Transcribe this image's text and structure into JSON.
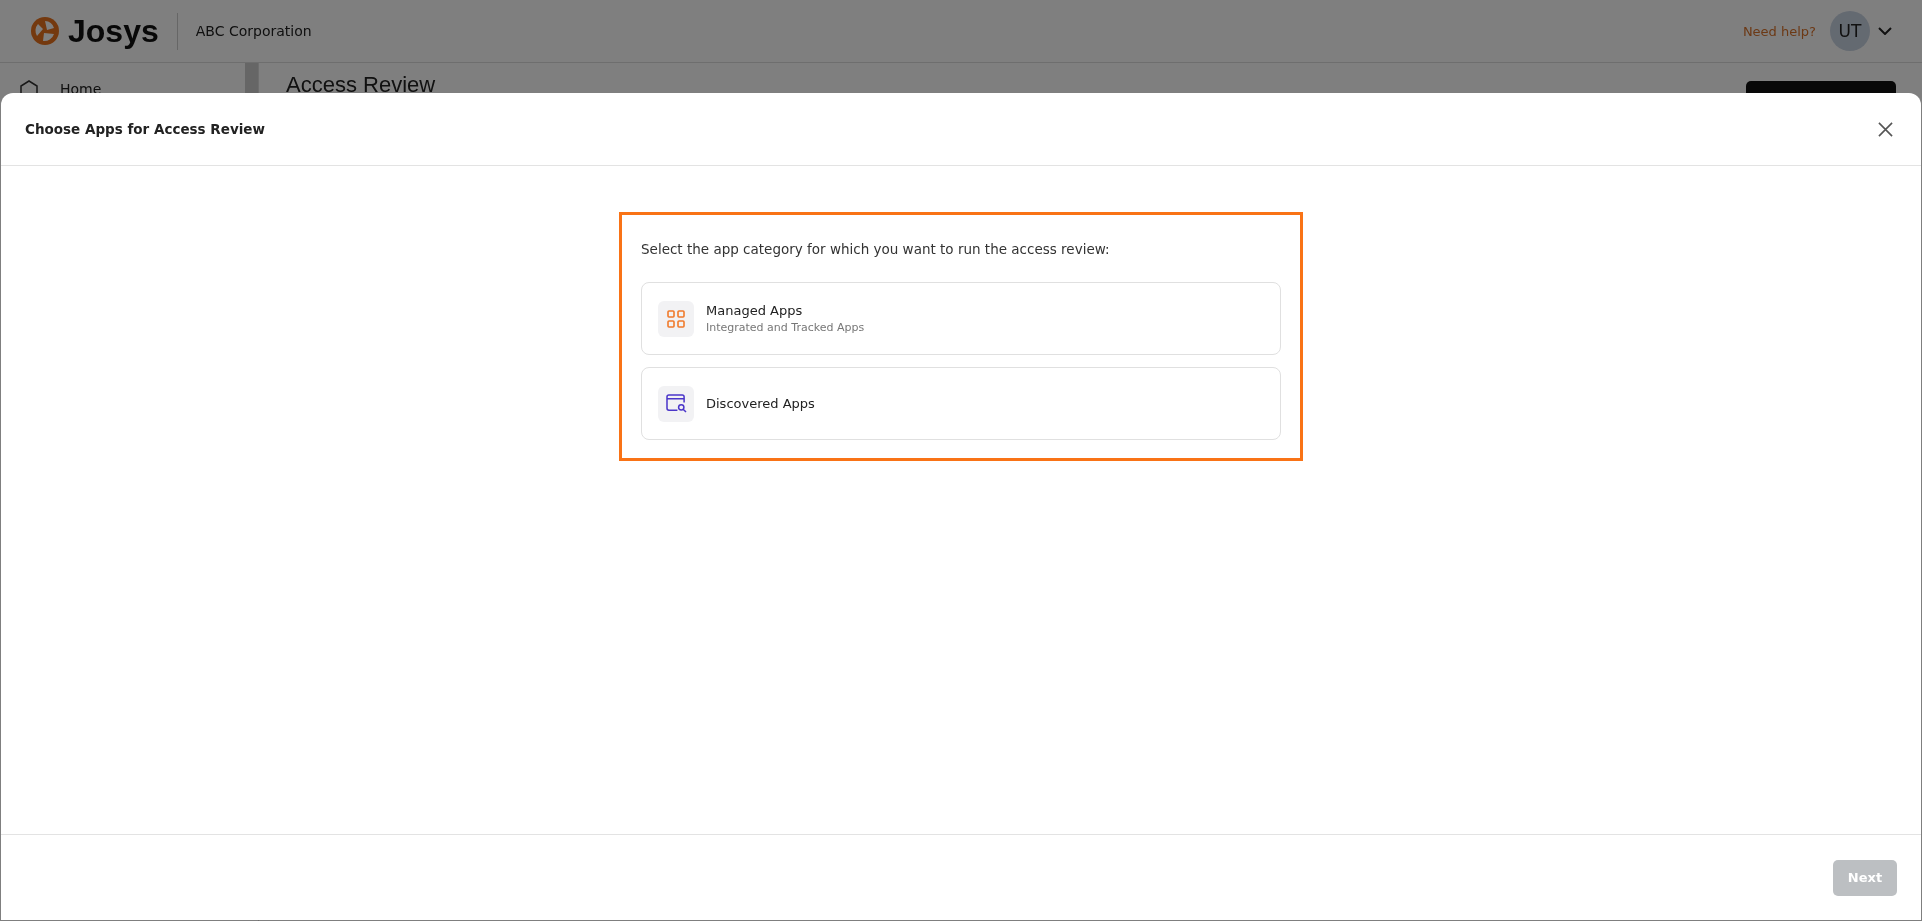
{
  "header": {
    "logo": "Josys",
    "organization": "ABC Corporation",
    "help_link": "Need help?",
    "avatar": "UT"
  },
  "sidebar": {
    "items": [
      {
        "label": "Home"
      }
    ]
  },
  "page": {
    "title": "Access Review"
  },
  "modal": {
    "title": "Choose Apps for Access Review",
    "prompt": "Select the app category for which you want to run the access review:",
    "options": [
      {
        "kind": "managed",
        "title": "Managed Apps",
        "subtitle": "Integrated and Tracked Apps"
      },
      {
        "kind": "discovered",
        "title": "Discovered Apps"
      }
    ],
    "next_button": {
      "label": "Next",
      "disabled": true
    }
  }
}
